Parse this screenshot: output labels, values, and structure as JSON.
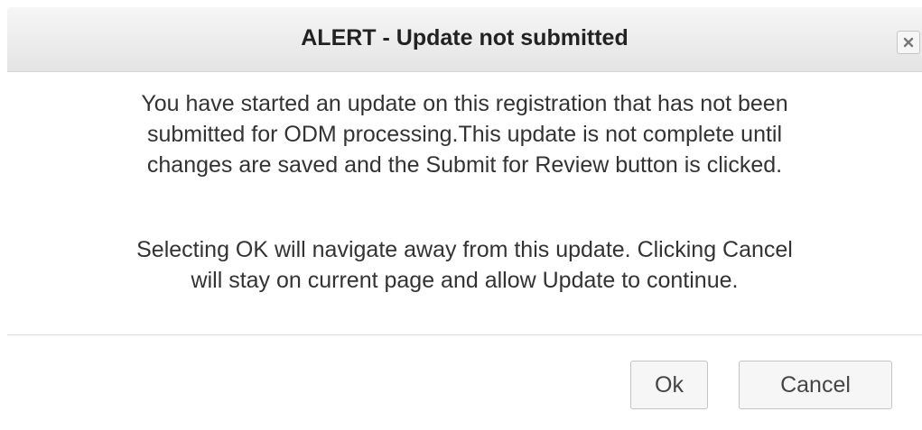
{
  "dialog": {
    "title": "ALERT - Update not submitted",
    "close_icon": "close-icon",
    "message_paragraph_1_lines": [
      "You have started an update on this registration that has not been",
      "submitted for ODM processing.This update is not complete until",
      "changes are saved and the Submit for Review button is clicked."
    ],
    "message_paragraph_2_lines": [
      "Selecting OK will navigate away from this update. Clicking Cancel",
      "will stay on current page and allow Update to continue."
    ],
    "buttons": {
      "ok_label": "Ok",
      "cancel_label": "Cancel"
    }
  }
}
